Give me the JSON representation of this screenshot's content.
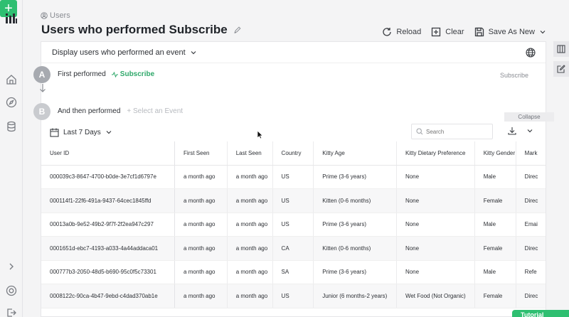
{
  "breadcrumb": {
    "label": "Users"
  },
  "page": {
    "title": "Users who performed Subscribe"
  },
  "toolbar": {
    "reload": "Reload",
    "clear": "Clear",
    "save_as_new": "Save As New"
  },
  "query": {
    "selector": "Display users who performed an event",
    "step_a": {
      "letter": "A",
      "label": "First performed",
      "event": "Subscribe",
      "right_label": "Subscribe"
    },
    "step_b": {
      "letter": "B",
      "label": "And then performed",
      "select_placeholder": "+ Select an Event"
    },
    "collapse": "Collapse"
  },
  "date_range": {
    "label": "Last 7 Days"
  },
  "search": {
    "placeholder": "Search"
  },
  "table": {
    "headers": [
      "User ID",
      "First Seen",
      "Last Seen",
      "Country",
      "Kitty Age",
      "Kitty Dietary Preference",
      "Kitty Gender",
      "Mark"
    ],
    "rows": [
      [
        "000039c3-8647-4700-b0de-3e7cf1d6797e",
        "a month ago",
        "a month ago",
        "US",
        "Prime (3-6 years)",
        "None",
        "Male",
        "Direc"
      ],
      [
        "000114f1-22f6-491a-9437-64cec1845ffd",
        "a month ago",
        "a month ago",
        "US",
        "Kitten (0-6 months)",
        "None",
        "Female",
        "Direc"
      ],
      [
        "00013a0b-9e52-49b2-9f7f-2f2ea947c297",
        "a month ago",
        "a month ago",
        "US",
        "Prime (3-6 years)",
        "None",
        "Male",
        "Emai"
      ],
      [
        "0001651d-ebc7-4193-a033-4a44addaca01",
        "a month ago",
        "a month ago",
        "CA",
        "Kitten (0-6 months)",
        "None",
        "Female",
        "Direc"
      ],
      [
        "000777b3-2050-48d5-b690-95c0f5c73301",
        "a month ago",
        "a month ago",
        "SA",
        "Prime (3-6 years)",
        "None",
        "Male",
        "Refe"
      ],
      [
        "0008122c-90ca-4b47-9ebd-c4dad370ab1e",
        "a month ago",
        "a month ago",
        "US",
        "Junior (6 months-2 years)",
        "Wet Food (Not Organic)",
        "Female",
        "Direc"
      ]
    ]
  },
  "tutorial": {
    "label": "Tutorial"
  },
  "colors": {
    "accent": "#2fbf71",
    "event_green": "#2fa86a"
  }
}
